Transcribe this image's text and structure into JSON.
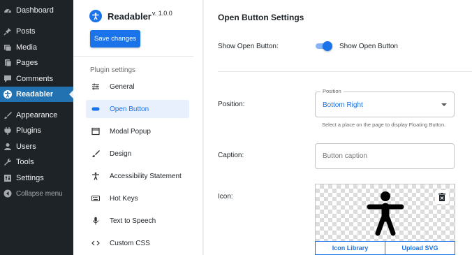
{
  "wp_menu": {
    "items": [
      {
        "label": "Dashboard",
        "icon": "dashboard-icon"
      },
      {
        "label": "Posts",
        "icon": "pin-icon"
      },
      {
        "label": "Media",
        "icon": "media-icon"
      },
      {
        "label": "Pages",
        "icon": "pages-icon"
      },
      {
        "label": "Comments",
        "icon": "comments-icon"
      },
      {
        "label": "Readabler",
        "icon": "accessibility-icon"
      },
      {
        "label": "Appearance",
        "icon": "brush-icon"
      },
      {
        "label": "Plugins",
        "icon": "plug-icon"
      },
      {
        "label": "Users",
        "icon": "user-icon"
      },
      {
        "label": "Tools",
        "icon": "wrench-icon"
      },
      {
        "label": "Settings",
        "icon": "settings-icon"
      }
    ],
    "collapse_label": "Collapse menu",
    "active_color": "#2271b1"
  },
  "plugin": {
    "name": "Readabler",
    "version": "v. 1.0.0",
    "save_label": "Save changes",
    "section_label": "Plugin settings",
    "nav": [
      {
        "label": "General",
        "icon": "sliders-icon"
      },
      {
        "label": "Open Button",
        "icon": "toggle-icon"
      },
      {
        "label": "Modal Popup",
        "icon": "window-icon"
      },
      {
        "label": "Design",
        "icon": "brush-icon"
      },
      {
        "label": "Accessibility Statement",
        "icon": "accessibility-icon"
      },
      {
        "label": "Hot Keys",
        "icon": "keyboard-icon"
      },
      {
        "label": "Text to Speech",
        "icon": "microphone-icon"
      },
      {
        "label": "Custom CSS",
        "icon": "code-icon"
      }
    ],
    "accent_color": "#1a73e8"
  },
  "settings": {
    "title": "Open Button Settings",
    "show_button": {
      "label": "Show Open Button:",
      "toggle_text": "Show Open Button",
      "enabled": true
    },
    "position": {
      "label": "Position:",
      "legend": "Position",
      "value": "Bottom Right",
      "hint": "Select a place on the page to display Floating Button."
    },
    "caption": {
      "label": "Caption:",
      "placeholder": "Button caption",
      "value": ""
    },
    "icon": {
      "label": "Icon:",
      "library_label": "Icon Library",
      "upload_label": "Upload SVG"
    }
  }
}
